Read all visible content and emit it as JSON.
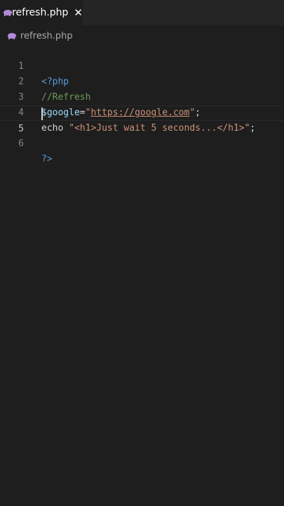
{
  "tab": {
    "filename": "refresh.php",
    "close_glyph": "✕",
    "icon": "php-elephant-icon"
  },
  "breadcrumb": {
    "filename": "refresh.php",
    "icon": "php-elephant-icon"
  },
  "colors": {
    "background": "#1e1e1e",
    "tag": "#569cd6",
    "comment": "#6a9955",
    "string": "#ce9178",
    "variable": "#9cdcfe",
    "icon": "#b48ad8"
  },
  "editor": {
    "lines": [
      {
        "number": "1",
        "open_tag": "<?php"
      },
      {
        "number": "2",
        "comment": "//Refresh"
      },
      {
        "number": "3",
        "var": "$google",
        "eq": "=",
        "q1": "\"",
        "url": "https://google.com",
        "q2": "\"",
        "end": ";"
      },
      {
        "number": "4",
        "kw": "echo ",
        "str": "\"<h1>Just wait 5 seconds...</h1>\"",
        "end": ";"
      },
      {
        "number": "5"
      },
      {
        "number": "6",
        "close_tag": "?>"
      }
    ]
  }
}
